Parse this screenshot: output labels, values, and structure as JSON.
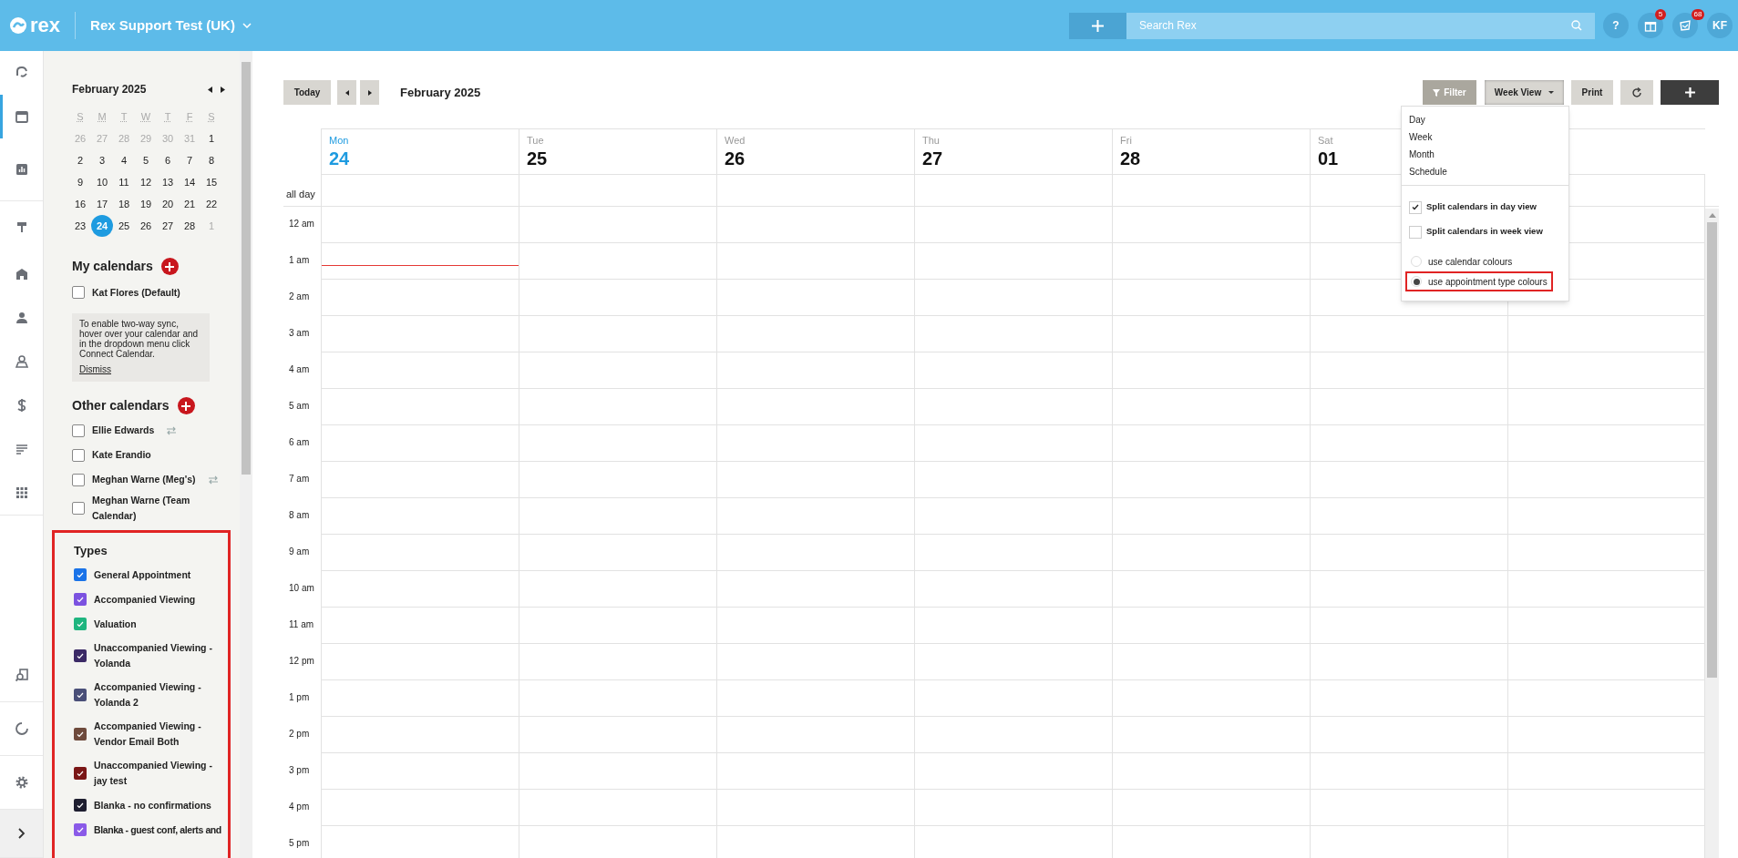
{
  "topbar": {
    "brand": "rex",
    "account": "Rex Support Test (UK)",
    "search_placeholder": "Search Rex",
    "help": "?",
    "gift_badge": "5",
    "notification_badge": "68",
    "user_initials": "KF"
  },
  "nav_items": [
    {
      "selected": false
    },
    {
      "selected": true
    },
    {
      "selected": false
    },
    {
      "selected": false
    },
    {
      "selected": false
    },
    {
      "selected": false
    },
    {
      "selected": false
    },
    {
      "selected": false
    },
    {
      "selected": false
    },
    {
      "selected": false
    },
    {
      "selected": false
    },
    {
      "selected": false
    },
    {
      "selected": false
    },
    {
      "selected": false
    }
  ],
  "mini_calendar": {
    "title": "February 2025",
    "weekdays": [
      "S",
      "M",
      "T",
      "W",
      "T",
      "F",
      "S"
    ],
    "weeks": [
      [
        {
          "label": "26",
          "muted": true,
          "selected": false
        },
        {
          "label": "27",
          "muted": true,
          "selected": false
        },
        {
          "label": "28",
          "muted": true,
          "selected": false
        },
        {
          "label": "29",
          "muted": true,
          "selected": false
        },
        {
          "label": "30",
          "muted": true,
          "selected": false
        },
        {
          "label": "31",
          "muted": true,
          "selected": false
        },
        {
          "label": "1",
          "muted": false,
          "selected": false
        }
      ],
      [
        {
          "label": "2",
          "muted": false,
          "selected": false
        },
        {
          "label": "3",
          "muted": false,
          "selected": false
        },
        {
          "label": "4",
          "muted": false,
          "selected": false
        },
        {
          "label": "5",
          "muted": false,
          "selected": false
        },
        {
          "label": "6",
          "muted": false,
          "selected": false
        },
        {
          "label": "7",
          "muted": false,
          "selected": false
        },
        {
          "label": "8",
          "muted": false,
          "selected": false
        }
      ],
      [
        {
          "label": "9",
          "muted": false,
          "selected": false
        },
        {
          "label": "10",
          "muted": false,
          "selected": false
        },
        {
          "label": "11",
          "muted": false,
          "selected": false
        },
        {
          "label": "12",
          "muted": false,
          "selected": false
        },
        {
          "label": "13",
          "muted": false,
          "selected": false
        },
        {
          "label": "14",
          "muted": false,
          "selected": false
        },
        {
          "label": "15",
          "muted": false,
          "selected": false
        }
      ],
      [
        {
          "label": "16",
          "muted": false,
          "selected": false
        },
        {
          "label": "17",
          "muted": false,
          "selected": false
        },
        {
          "label": "18",
          "muted": false,
          "selected": false
        },
        {
          "label": "19",
          "muted": false,
          "selected": false
        },
        {
          "label": "20",
          "muted": false,
          "selected": false
        },
        {
          "label": "21",
          "muted": false,
          "selected": false
        },
        {
          "label": "22",
          "muted": false,
          "selected": false
        }
      ],
      [
        {
          "label": "23",
          "muted": false,
          "selected": false
        },
        {
          "label": "24",
          "muted": false,
          "selected": true
        },
        {
          "label": "25",
          "muted": false,
          "selected": false
        },
        {
          "label": "26",
          "muted": false,
          "selected": false
        },
        {
          "label": "27",
          "muted": false,
          "selected": false
        },
        {
          "label": "28",
          "muted": false,
          "selected": false
        },
        {
          "label": "1",
          "muted": true,
          "selected": false
        }
      ]
    ]
  },
  "my_calendars": {
    "heading": "My calendars",
    "items": [
      {
        "label": "Kat Flores (Default)",
        "checked": false
      }
    ],
    "notice": "To enable two-way sync, hover over your calendar and in the dropdown menu click Connect Calendar.",
    "dismiss": "Dismiss"
  },
  "other_calendars": {
    "heading": "Other calendars",
    "items": [
      {
        "label": "Ellie Edwards",
        "checked": false,
        "synced": true
      },
      {
        "label": "Kate Erandio",
        "checked": false,
        "synced": false
      },
      {
        "label": "Meghan Warne (Meg's)",
        "checked": false,
        "synced": true
      },
      {
        "label": "Meghan Warne (Team Calendar)",
        "checked": false,
        "synced": false
      }
    ]
  },
  "types": {
    "heading": "Types",
    "highlighted": true,
    "items": [
      {
        "label": "General Appointment",
        "checked": true,
        "color": "#1a73e8"
      },
      {
        "label": "Accompanied Viewing",
        "checked": true,
        "color": "#7b52e0"
      },
      {
        "label": "Valuation",
        "checked": true,
        "color": "#1fb57f"
      },
      {
        "label": "Unaccompanied Viewing - Yolanda",
        "checked": true,
        "color": "#3b2a66"
      },
      {
        "label": "Accompanied Viewing - Yolanda 2",
        "checked": true,
        "color": "#4a4f78"
      },
      {
        "label": "Accompanied Viewing - Vendor Email Both",
        "checked": true,
        "color": "#6e4a3c"
      },
      {
        "label": "Unaccompanied Viewing - jay test",
        "checked": true,
        "color": "#7a1616"
      },
      {
        "label": "Blanka - no confirmations",
        "checked": true,
        "color": "#1e1e30"
      },
      {
        "label": "Blanka - guest conf, alerts and",
        "checked": true,
        "color": "#8a5ae8"
      }
    ]
  },
  "toolbar": {
    "today": "Today",
    "title": "February 2025",
    "filter": "Filter",
    "view": "Week View",
    "print": "Print"
  },
  "days": [
    {
      "weekday": "Mon",
      "date": "24",
      "selected": true
    },
    {
      "weekday": "Tue",
      "date": "25",
      "selected": false
    },
    {
      "weekday": "Wed",
      "date": "26",
      "selected": false
    },
    {
      "weekday": "Thu",
      "date": "27",
      "selected": false
    },
    {
      "weekday": "Fri",
      "date": "28",
      "selected": false
    },
    {
      "weekday": "Sat",
      "date": "01",
      "selected": false
    }
  ],
  "all_day_label": "all day",
  "hours": [
    "12 am",
    "1 am",
    "2 am",
    "3 am",
    "4 am",
    "5 am",
    "6 am",
    "7 am",
    "8 am",
    "9 am",
    "10 am",
    "11 am",
    "12 pm",
    "1 pm",
    "2 pm",
    "3 pm",
    "4 pm",
    "5 pm"
  ],
  "view_menu": {
    "views": [
      "Day",
      "Week",
      "Month",
      "Schedule"
    ],
    "options": [
      {
        "label": "Split calendars in day view",
        "checked": true
      },
      {
        "label": "Split calendars in week view",
        "checked": false
      }
    ],
    "colour_modes": [
      {
        "label": "use calendar colours",
        "selected": false,
        "highlighted": false
      },
      {
        "label": "use appointment type colours",
        "selected": true,
        "highlighted": true
      }
    ]
  }
}
